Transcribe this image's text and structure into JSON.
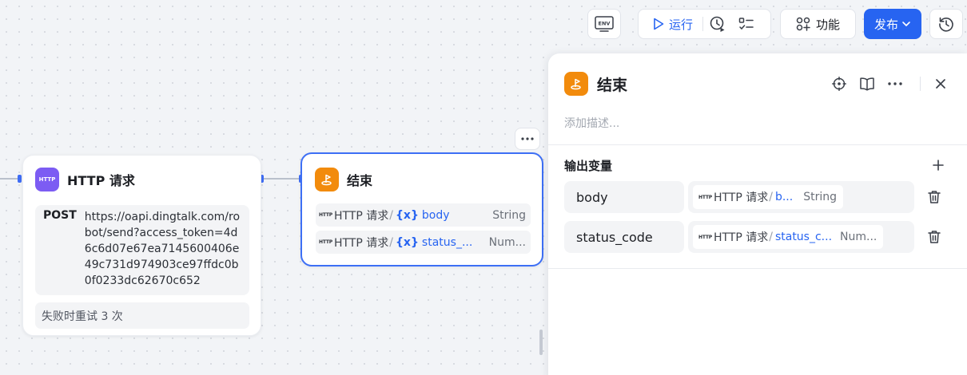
{
  "toolbar": {
    "env_label": "ENV",
    "run_label": "运行",
    "function_label": "功能",
    "publish_label": "发布"
  },
  "canvas": {
    "http_node": {
      "title": "HTTP 请求",
      "icon_label": "HTTP",
      "method": "POST",
      "url": "https://oapi.dingtalk.com/robot/send?access_token=4d6c6d07e67ea7145600406e49c731d974903ce97ffdc0b0f0233dc62670c652",
      "retry_text": "失败时重试 3 次"
    },
    "end_node": {
      "title": "结束",
      "outputs": [
        {
          "tag": "HTTP",
          "source": "HTTP 请求",
          "var_icon": "{x}",
          "var": "body",
          "type": "String"
        },
        {
          "tag": "HTTP",
          "source": "HTTP 请求",
          "var_icon": "{x}",
          "var": "status_...",
          "type": "Num..."
        }
      ]
    }
  },
  "panel": {
    "title": "结束",
    "description_placeholder": "添加描述...",
    "section_title": "输出变量",
    "variables": [
      {
        "name": "body",
        "tag": "HTTP",
        "source": "HTTP 请求",
        "var": "b...",
        "type": "String"
      },
      {
        "name": "status_code",
        "tag": "HTTP",
        "source": "HTTP 请求",
        "var": "status_c...",
        "type": "Num..."
      }
    ]
  },
  "colors": {
    "accent": "#2764f1",
    "http_icon": "#7c5cf3",
    "end_icon": "#f28b0c",
    "selected_border": "#3d6ff5"
  },
  "icons": [
    "env-icon",
    "play-icon",
    "debug-clock-icon",
    "checklist-icon",
    "apps-icon",
    "chevron-down-icon",
    "history-icon",
    "more-icon",
    "locate-icon",
    "docs-icon",
    "close-icon",
    "plus-icon",
    "trash-icon",
    "end-flag-icon"
  ]
}
